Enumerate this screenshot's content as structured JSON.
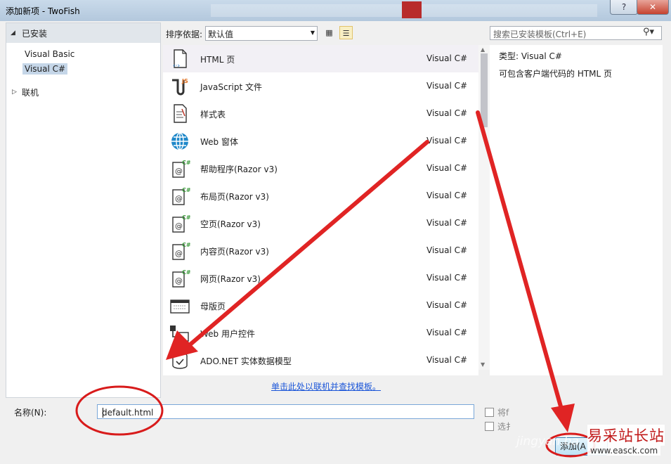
{
  "window": {
    "title": "添加新项 - TwoFish",
    "help_label": "?",
    "close_label": "✕"
  },
  "left_panel": {
    "installed_label": "已安装",
    "items": [
      {
        "label": "Visual Basic",
        "selected": false
      },
      {
        "label": "Visual C#",
        "selected": true
      }
    ],
    "online_label": "联机"
  },
  "toolbar": {
    "sort_label": "排序依据:",
    "sort_value": "默认值"
  },
  "search": {
    "placeholder": "搜索已安装模板(Ctrl+E)"
  },
  "templates": [
    {
      "name": "HTML 页",
      "lang": "Visual C#",
      "icon": "html-page-icon"
    },
    {
      "name": "JavaScript 文件",
      "lang": "Visual C#",
      "icon": "javascript-file-icon"
    },
    {
      "name": "样式表",
      "lang": "Visual C#",
      "icon": "stylesheet-icon"
    },
    {
      "name": "Web 窗体",
      "lang": "Visual C#",
      "icon": "web-form-icon"
    },
    {
      "name": "帮助程序(Razor v3)",
      "lang": "Visual C#",
      "icon": "razor-icon"
    },
    {
      "name": "布局页(Razor v3)",
      "lang": "Visual C#",
      "icon": "razor-icon"
    },
    {
      "name": "空页(Razor v3)",
      "lang": "Visual C#",
      "icon": "razor-icon"
    },
    {
      "name": "内容页(Razor v3)",
      "lang": "Visual C#",
      "icon": "razor-icon"
    },
    {
      "name": "网页(Razor v3)",
      "lang": "Visual C#",
      "icon": "razor-icon"
    },
    {
      "name": "母版页",
      "lang": "Visual C#",
      "icon": "master-page-icon"
    },
    {
      "name": "Web 用户控件",
      "lang": "Visual C#",
      "icon": "user-control-icon"
    },
    {
      "name": "ADO.NET 实体数据模型",
      "lang": "Visual C#",
      "icon": "ado-net-icon"
    }
  ],
  "online_link": "单击此处以联机并查找模板。",
  "details": {
    "type_line": "类型:  Visual C#",
    "description": "可包含客户端代码的 HTML 页"
  },
  "bottom": {
    "name_label": "名称(N):",
    "name_value": "default.html",
    "check1_label": "将f",
    "check2_label": "选扌",
    "add_button": "添加(A"
  },
  "watermark": {
    "line1": "易采站长站",
    "line2": "www.easck.com",
    "faint": "jingyan.ba"
  },
  "colors": {
    "annotation_red": "#e02424",
    "link_blue": "#1a55d8",
    "selection": "#c5d6e8"
  }
}
